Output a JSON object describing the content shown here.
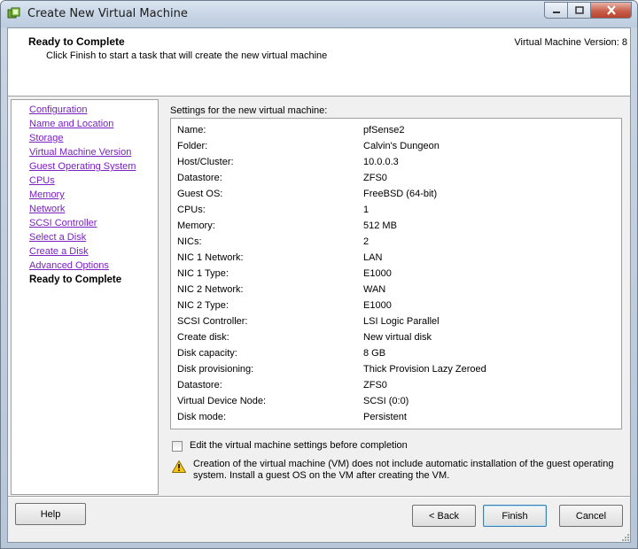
{
  "window": {
    "title": "Create New Virtual Machine"
  },
  "header": {
    "title": "Ready to Complete",
    "subtitle": "Click Finish to start a task that will create the new virtual machine",
    "version": "Virtual Machine Version: 8"
  },
  "nav": {
    "items": [
      {
        "label": "Configuration",
        "state": "link"
      },
      {
        "label": "Name and Location",
        "state": "link"
      },
      {
        "label": "Storage",
        "state": "link"
      },
      {
        "label": "Virtual Machine Version",
        "state": "link"
      },
      {
        "label": "Guest Operating System",
        "state": "link"
      },
      {
        "label": "CPUs",
        "state": "link"
      },
      {
        "label": "Memory",
        "state": "link"
      },
      {
        "label": "Network",
        "state": "link"
      },
      {
        "label": "SCSI Controller",
        "state": "link"
      },
      {
        "label": "Select a Disk",
        "state": "link"
      },
      {
        "label": "Create a Disk",
        "state": "link"
      },
      {
        "label": "Advanced Options",
        "state": "link"
      },
      {
        "label": "Ready to Complete",
        "state": "current"
      }
    ]
  },
  "settings": {
    "label": "Settings for the new virtual machine:",
    "rows": [
      {
        "key": "Name:",
        "value": "pfSense2"
      },
      {
        "key": "Folder:",
        "value": "Calvin's Dungeon"
      },
      {
        "key": "Host/Cluster:",
        "value": "10.0.0.3"
      },
      {
        "key": "Datastore:",
        "value": "ZFS0"
      },
      {
        "key": "Guest OS:",
        "value": "FreeBSD (64-bit)"
      },
      {
        "key": "CPUs:",
        "value": "1"
      },
      {
        "key": "Memory:",
        "value": "512 MB"
      },
      {
        "key": "NICs:",
        "value": "2"
      },
      {
        "key": "NIC 1 Network:",
        "value": "LAN"
      },
      {
        "key": "NIC 1 Type:",
        "value": "E1000"
      },
      {
        "key": "NIC 2 Network:",
        "value": "WAN"
      },
      {
        "key": "NIC 2 Type:",
        "value": "E1000"
      },
      {
        "key": "SCSI Controller:",
        "value": "LSI Logic Parallel"
      },
      {
        "key": "Create disk:",
        "value": "New virtual disk"
      },
      {
        "key": "Disk capacity:",
        "value": "8 GB"
      },
      {
        "key": "Disk provisioning:",
        "value": "Thick Provision Lazy Zeroed"
      },
      {
        "key": "Datastore:",
        "value": "ZFS0"
      },
      {
        "key": "Virtual Device Node:",
        "value": "SCSI (0:0)"
      },
      {
        "key": "Disk mode:",
        "value": "Persistent"
      }
    ]
  },
  "edit_option": {
    "label": "Edit the virtual machine settings before completion",
    "checked": false
  },
  "warning": {
    "icon": "warning-icon",
    "text": "Creation of the virtual machine (VM) does not include automatic installation of the guest operating system. Install a guest OS on the VM after creating the VM."
  },
  "buttons": {
    "help": "Help",
    "back": "< Back",
    "finish": "Finish",
    "cancel": "Cancel"
  },
  "colors": {
    "link": "#7a21c4",
    "panel": "#f0f0f0",
    "default_button_border": "#3c7fb1"
  }
}
